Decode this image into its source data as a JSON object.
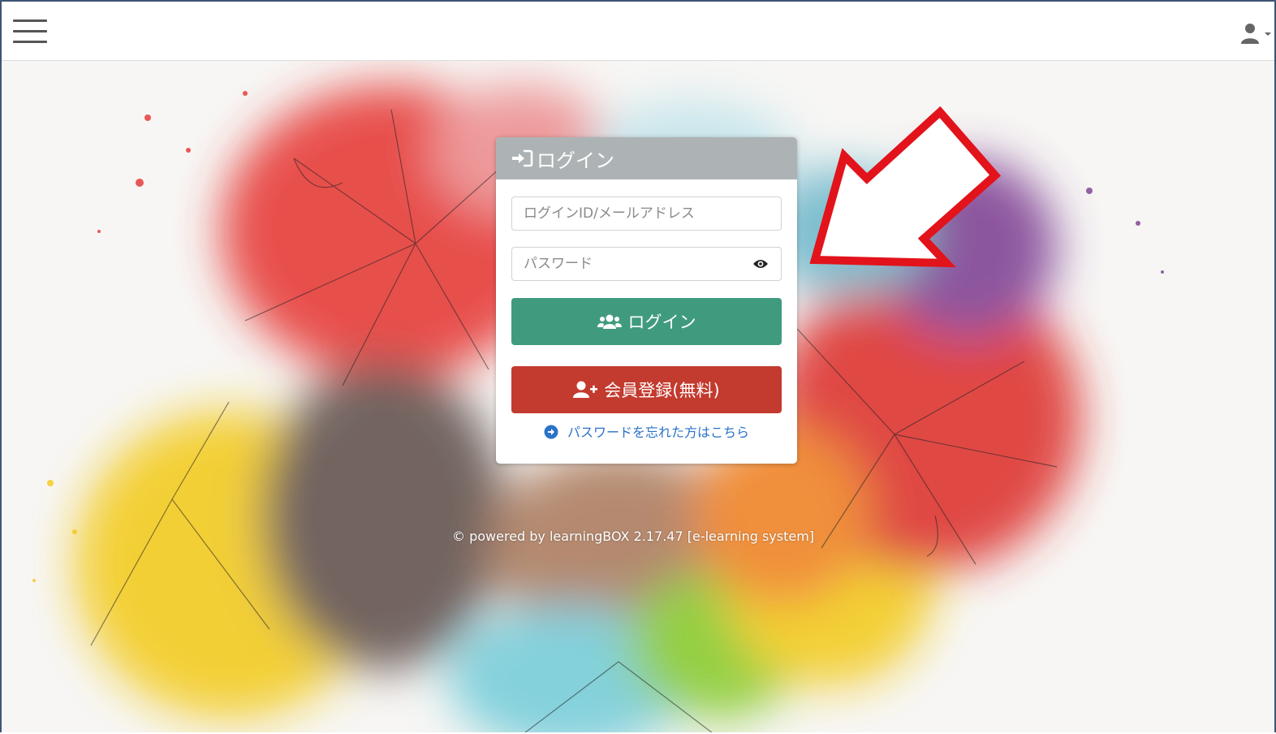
{
  "login_card": {
    "title": "ログイン",
    "id_placeholder": "ログインID/メールアドレス",
    "password_placeholder": "パスワード",
    "login_button": "ログイン",
    "register_button": "会員登録(無料)",
    "forgot_link": "パスワードを忘れた方はこちら"
  },
  "footer": {
    "powered_by": "© powered by learningBOX 2.17.47 [e-learning system]"
  },
  "icons": {
    "menu": "hamburger-icon",
    "user": "user-icon",
    "login": "sign-in-icon",
    "password_toggle": "eye-icon",
    "login_button": "users-icon",
    "register_button": "user-plus-icon",
    "forgot": "arrow-circle-right-icon",
    "annotation": "red-arrow"
  },
  "colors": {
    "header": "#adb3b5",
    "login_button": "#409b7e",
    "register_button": "#c33a2e",
    "link": "#2a73c8",
    "annotation": "#e2131a"
  }
}
